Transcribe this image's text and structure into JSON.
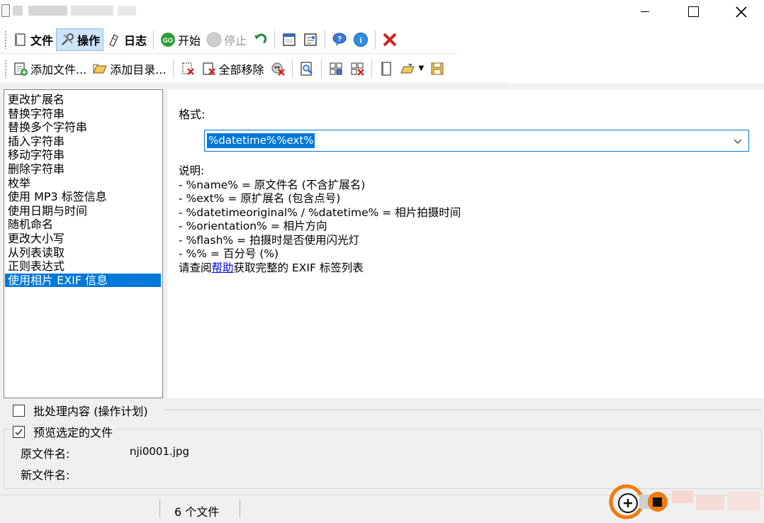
{
  "window": {
    "title": "",
    "controls": {
      "minimize": "minimize",
      "maximize": "maximize",
      "close": "close"
    }
  },
  "toolbar_main": {
    "file": "文件",
    "actions": "操作",
    "log": "日志",
    "start": "开始",
    "stop": "停止",
    "icons": [
      "undo-icon",
      "window-icon",
      "settings-icon",
      "help-icon",
      "info-icon",
      "exit-icon"
    ]
  },
  "toolbar_files": {
    "add_files": "添加文件...",
    "add_folder": "添加目录...",
    "remove_all": "全部移除"
  },
  "operations": [
    "更改扩展名",
    "替换字符串",
    "替换多个字符串",
    "插入字符串",
    "移动字符串",
    "删除字符串",
    "枚举",
    "使用 MP3 标签信息",
    "使用日期与时间",
    "随机命名",
    "更改大小写",
    "从列表读取",
    "正则表达式",
    "使用相片 EXIF 信息"
  ],
  "selected_operation_index": 13,
  "panel": {
    "format_label": "格式:",
    "format_value": "%datetime%%ext%",
    "desc_title": "说明:",
    "desc_lines": [
      "- %name% = 原文件名 (不含扩展名)",
      "- %ext% = 原扩展名 (包含点号)",
      "- %datetimeoriginal% / %datetime% = 相片拍摄时间",
      "- %orientation% = 相片方向",
      "- %flash% = 拍摄时是否使用闪光灯",
      "- %% = 百分号 (%)"
    ],
    "help_prefix": "请查阅",
    "help_link": "帮助",
    "help_suffix": "获取完整的 EXIF 标签列表"
  },
  "batch": {
    "label": "批处理内容 (操作计划)",
    "checked": false
  },
  "preview": {
    "label": "预览选定的文件",
    "checked": true,
    "original_label": "原文件名:",
    "original_value": "nji0001.jpg",
    "new_label": "新文件名:",
    "new_value": ""
  },
  "status": {
    "file_count": "6 个文件"
  },
  "colors": {
    "accent": "#0078d7",
    "link": "#0000ee",
    "toggle_active": "#cce4f7"
  }
}
